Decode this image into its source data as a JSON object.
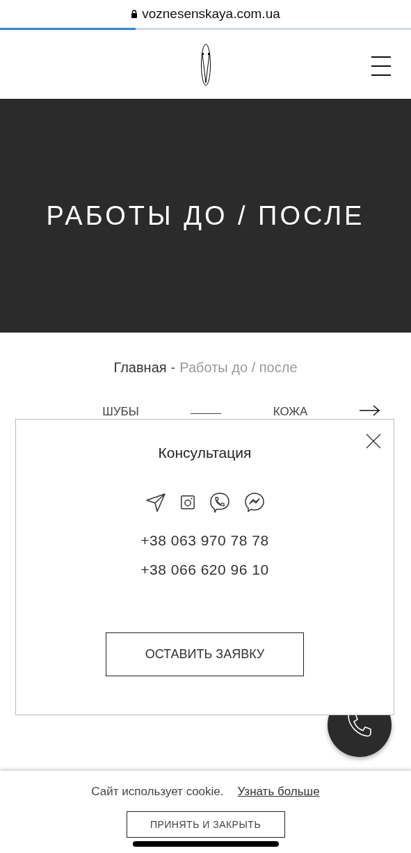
{
  "browser": {
    "url": "voznesenskaya.com.ua",
    "progress": {
      "level": 0.33
    }
  },
  "hero": {
    "title": "РАБОТЫ ДО / ПОСЛЕ"
  },
  "breadcrumb": {
    "home": "Главная",
    "separator": "-",
    "current": "Работы до / после"
  },
  "filters": [
    {
      "label": "ШУБЫ"
    },
    {
      "label": "КОЖА"
    }
  ],
  "modal": {
    "title": "Консультация",
    "phones": [
      "+38 063 970 78 78",
      "+38 066 620 96 10"
    ],
    "button": "ОСТАВИТЬ ЗАЯВКУ"
  },
  "cookie": {
    "text": "Сайт использует cookie.",
    "link": "Узнать больше",
    "button": "ПРИНЯТЬ И ЗАКРЫТЬ"
  }
}
